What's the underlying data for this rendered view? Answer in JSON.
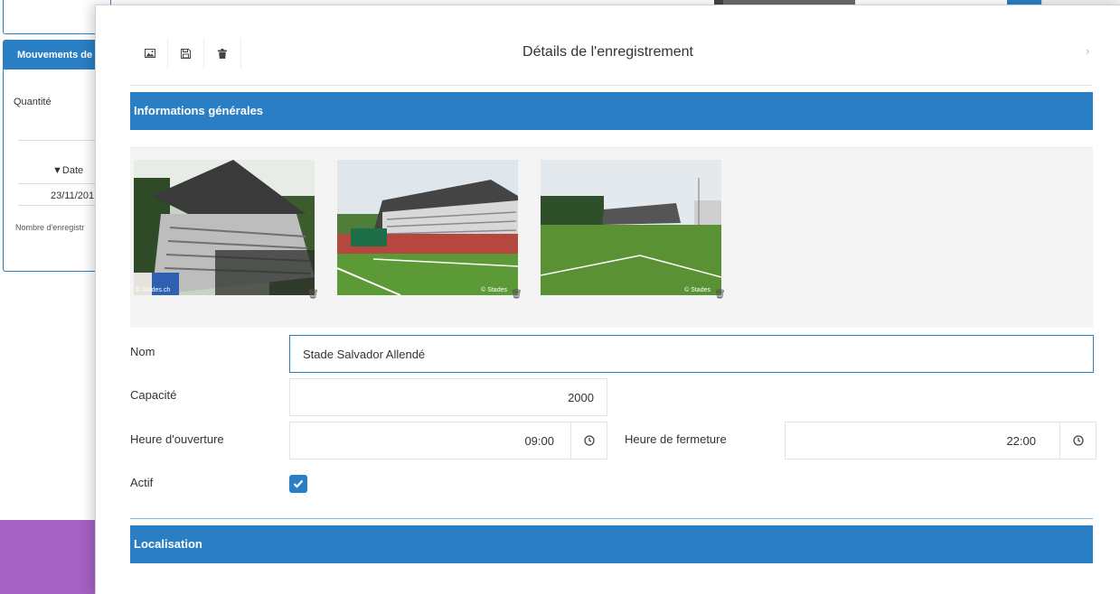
{
  "background": {
    "panel_title": "Mouvements de",
    "quantity_label": "Quantité",
    "date_header": "▼Date",
    "date_value": "23/11/201",
    "record_count": "Nombre d'enregistr",
    "colors": {
      "accent": "#2a7fc4",
      "purple": "#a561c3"
    }
  },
  "modal": {
    "title": "Détails de l'enregistrement",
    "toolbar": [
      {
        "name": "image-icon"
      },
      {
        "name": "save-icon"
      },
      {
        "name": "trash-icon"
      }
    ],
    "close_icon": "close-icon",
    "sections": {
      "general": "Informations générales",
      "location": "Localisation"
    },
    "photos": [
      {
        "credit": "© Stades.ch"
      },
      {
        "credit": "© Stades"
      },
      {
        "credit": "© Stades"
      }
    ],
    "form": {
      "name_label": "Nom",
      "name_value": "Stade Salvador Allendé",
      "capacity_label": "Capacité",
      "capacity_value": "2000",
      "opening_label": "Heure d'ouverture",
      "opening_value": "09:00",
      "closing_label": "Heure de fermeture",
      "closing_value": "22:00",
      "active_label": "Actif",
      "active_checked": true
    }
  }
}
